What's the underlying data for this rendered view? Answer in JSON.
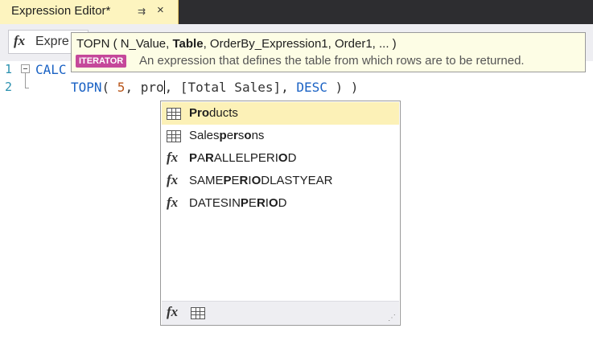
{
  "tab": {
    "title": "Expression Editor*",
    "pin": "⇉",
    "close": "×"
  },
  "formula": {
    "fx": "fx",
    "label": "Expre"
  },
  "gutter": {
    "line1": "1",
    "line2": "2"
  },
  "code": {
    "line1_kw": "CALC",
    "line2": {
      "fn": "TOPN",
      "p1": "( ",
      "num": "5",
      "p2": ", ",
      "typed": "pro",
      "p3": ", [Total Sales], ",
      "kw": "DESC",
      "p4": " ) )"
    }
  },
  "tooltip": {
    "sig_prefix": "TOPN ( N_Value, ",
    "sig_bold": "Table",
    "sig_suffix": ", OrderBy_Expression1, Order1, ... )",
    "badge": "ITERATOR",
    "description": "An expression that defines the table from which rows are to be returned."
  },
  "autocomplete": {
    "items": [
      {
        "icon": "table-icon",
        "label": "Products",
        "selected": true
      },
      {
        "icon": "table-icon",
        "label": "Salespersons",
        "selected": false
      },
      {
        "icon": "function-icon",
        "label": "PARALLELPERIOD",
        "selected": false
      },
      {
        "icon": "function-icon",
        "label": "SAMEPERIODLASTYEAR",
        "selected": false
      },
      {
        "icon": "function-icon",
        "label": "DATESINPERIOD",
        "selected": false
      }
    ],
    "footer": {
      "fx": "fx",
      "grip": "⋰"
    }
  },
  "colors": {
    "tab_bg": "#fdf4bf",
    "selected_item": "#fcf1b7",
    "keyword": "#1a62c4",
    "number": "#b8551a",
    "badge": "#c5489a"
  }
}
